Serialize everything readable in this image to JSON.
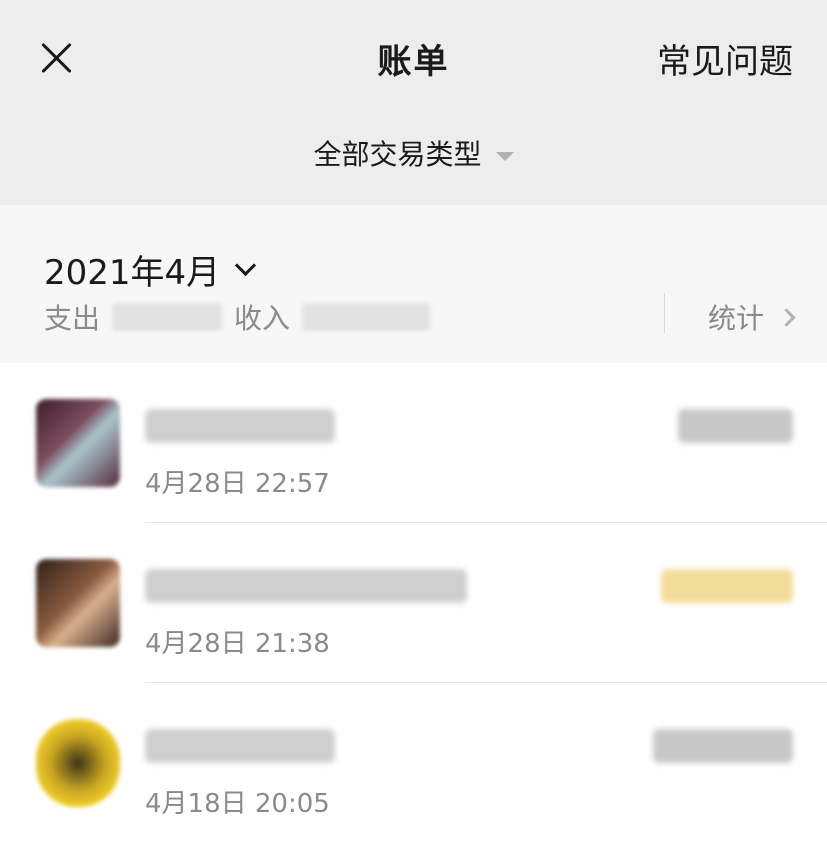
{
  "header": {
    "title": "账单",
    "faq_label": "常见问题",
    "close_icon": "close-icon"
  },
  "filter": {
    "label": "全部交易类型"
  },
  "month_bar": {
    "month": "2021年4月",
    "expense_label": "支出",
    "income_label": "收入",
    "stats_label": "统计"
  },
  "transactions": [
    {
      "time": "4月28日 22:57",
      "amount_color": "#c8c8c8"
    },
    {
      "time": "4月28日 21:38",
      "amount_color": "#f3dc9a"
    },
    {
      "time": "4月18日 20:05",
      "amount_color": "#c8c8c8"
    }
  ]
}
